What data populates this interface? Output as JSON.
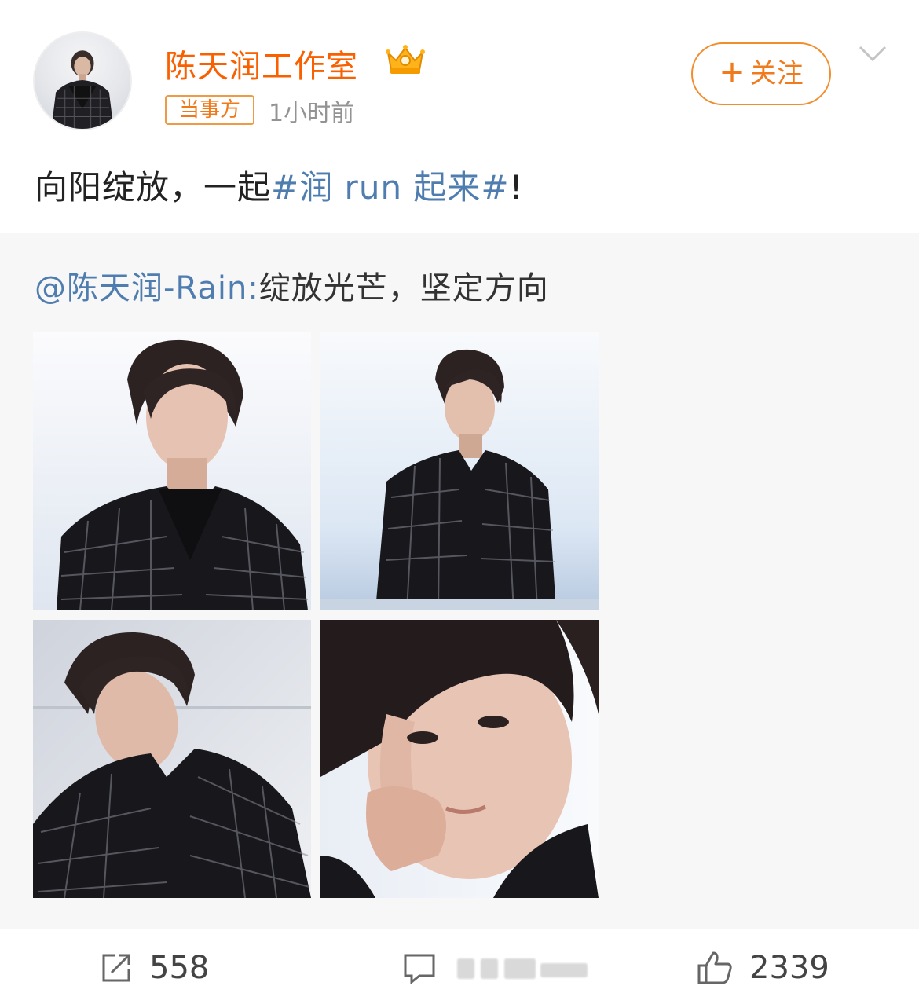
{
  "header": {
    "name": "陈天润工作室",
    "tag": "当事方",
    "time": "1小时前",
    "follow_label": "关注",
    "follow_plus": "+",
    "icons": {
      "crown": "vip-crown-icon",
      "chevron": "chevron-down-icon"
    },
    "accent_color": "#f86000"
  },
  "post": {
    "text_before": "向阳绽放，一起",
    "hashtag": "#润 run 起来#",
    "text_after": "!",
    "link_color": "#507daf"
  },
  "repost": {
    "mention": "@陈天润-Rain:",
    "text": "绽放光芒，坚定方向",
    "images": [
      {
        "name": "photo-1"
      },
      {
        "name": "photo-2"
      },
      {
        "name": "photo-3"
      },
      {
        "name": "photo-4"
      }
    ]
  },
  "footer": {
    "repost_count": "558",
    "like_count": "2339",
    "icons": {
      "repost": "share-icon",
      "comment": "comment-icon",
      "like": "thumbs-up-icon"
    }
  }
}
